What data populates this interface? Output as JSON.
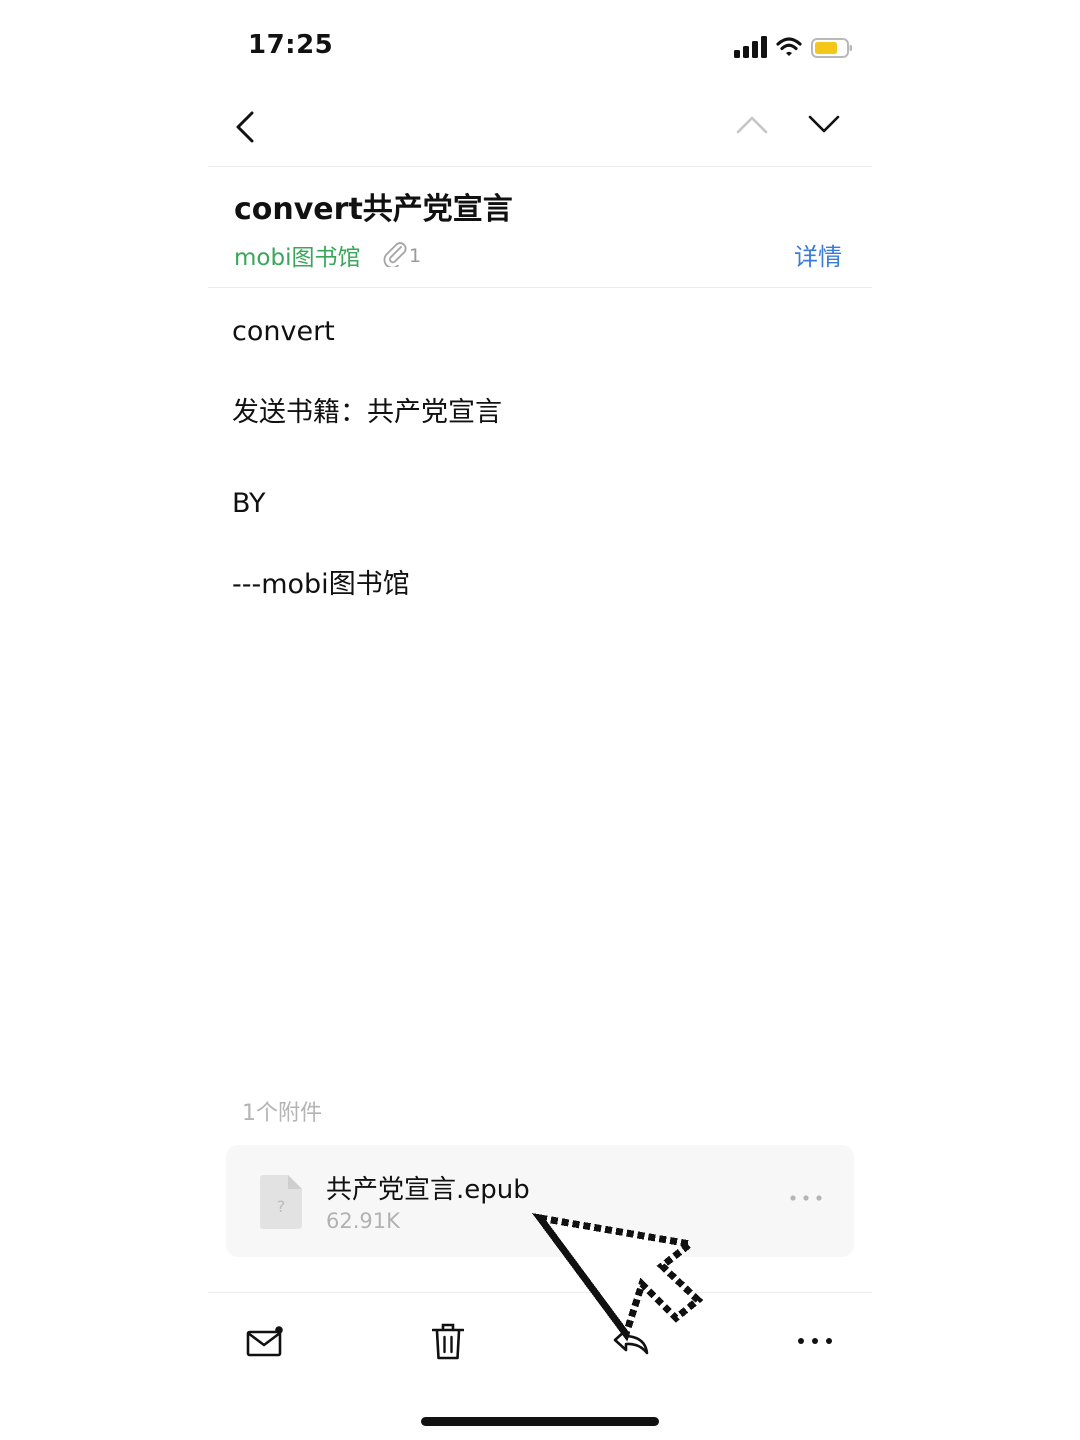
{
  "status_bar": {
    "time": "17:25",
    "battery_color": "#f5c518"
  },
  "nav": {
    "back_icon": "chevron-left-icon",
    "prev_icon": "chevron-up-icon",
    "next_icon": "chevron-down-icon"
  },
  "email": {
    "subject": "convert共产党宣言",
    "sender": "mobi图书馆",
    "attachment_count": "1",
    "details_label": "详情",
    "sender_color": "#3aa65a",
    "link_color": "#3a7bd5",
    "body": [
      "convert",
      "发送书籍：共产党宣言",
      "BY",
      "---mobi图书馆"
    ]
  },
  "attachments": {
    "label": "1个附件",
    "items": [
      {
        "name": "共产党宣言.epub",
        "size": "62.91K",
        "icon": "unknown-file-icon"
      }
    ]
  },
  "toolbar": {
    "items": [
      "mail-icon",
      "trash-icon",
      "reply-icon",
      "more-icon"
    ]
  }
}
